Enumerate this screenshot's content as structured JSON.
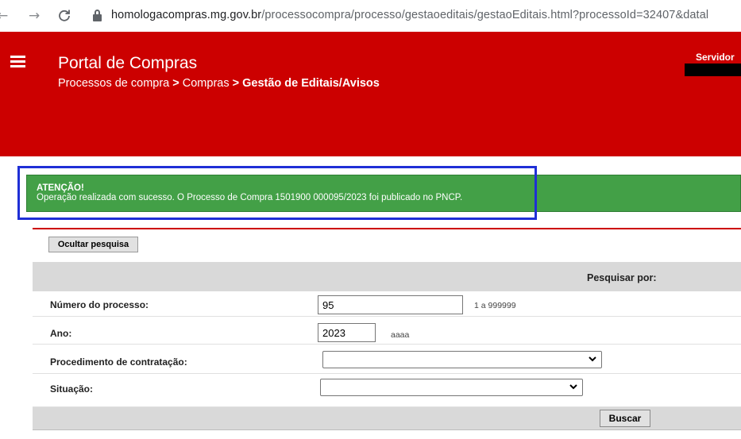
{
  "browser": {
    "back_icon": "←",
    "forward_icon": "→",
    "reload_icon": "C",
    "url_host": "homologacompras.mg.gov.br",
    "url_path": "/processocompra/processo/gestaoeditais/gestaoEditais.html?processoId=32407&datal"
  },
  "header": {
    "title": "Portal de Compras",
    "breadcrumb": {
      "part1": "Processos de compra",
      "sep1": " > ",
      "part2": "Compras",
      "sep2": " > ",
      "current": "Gestão de Editais/Avisos"
    },
    "user_label": "Servidor",
    "background_color": "#cc0000"
  },
  "alert": {
    "title": "ATENÇÃO!",
    "message": "Operação realizada com sucesso. O Processo de Compra 1501900 000095/2023 foi publicado no PNCP.",
    "color": "#43a047",
    "highlight_color": "#1f2fd6"
  },
  "search": {
    "hide_button": "Ocultar pesquisa",
    "header_label": "Pesquisar por:",
    "rows": {
      "numero": {
        "label": "Número do processo:",
        "value": "95",
        "hint": "1 a 999999"
      },
      "ano": {
        "label": "Ano:",
        "value": "2023",
        "hint": "aaaa"
      },
      "procedimento": {
        "label": "Procedimento de contratação:",
        "selected": ""
      },
      "situacao": {
        "label": "Situação:",
        "selected": ""
      }
    },
    "submit_button": "Buscar"
  }
}
